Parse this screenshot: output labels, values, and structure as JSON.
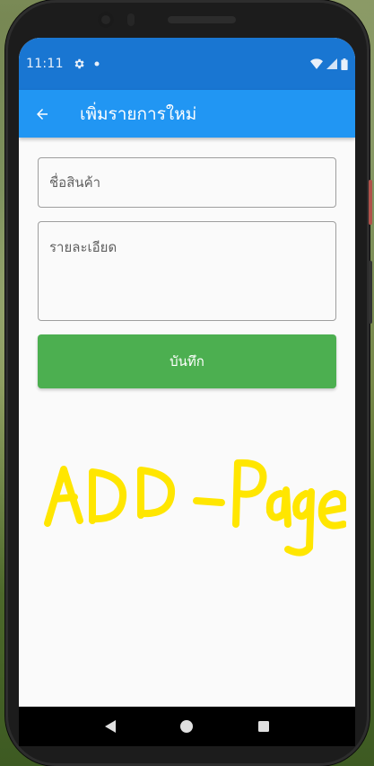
{
  "status_bar": {
    "time": "11:11",
    "icons": [
      "settings-icon",
      "dot-icon",
      "wifi-icon",
      "signal-icon",
      "battery-icon"
    ]
  },
  "app_bar": {
    "back_icon": "back-arrow-icon",
    "title": "เพิ่มรายการใหม่"
  },
  "form": {
    "name_placeholder": "ชื่อสินค้า",
    "detail_placeholder": "รายละเอียด",
    "save_label": "บันทึก"
  },
  "annotation": {
    "text": "ADD -Page",
    "color": "#ffe600"
  },
  "nav_bar": {
    "icons": [
      "back-triangle-icon",
      "home-circle-icon",
      "recents-square-icon"
    ]
  },
  "colors": {
    "status_bar": "#1976d2",
    "app_bar": "#2196f3",
    "save_button": "#4caf50",
    "screen_bg": "#fafafa"
  }
}
